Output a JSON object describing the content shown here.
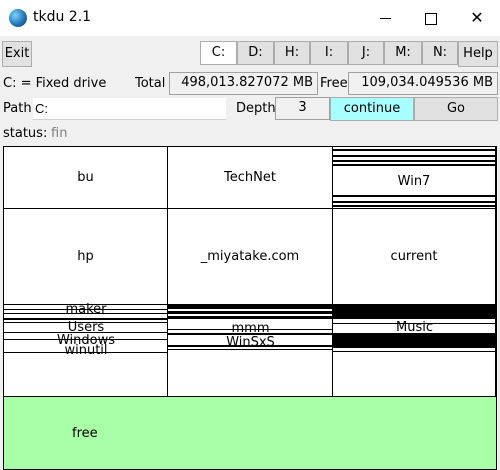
{
  "window": {
    "title": "tkdu 2.1"
  },
  "toolbar": {
    "exit_label": "Exit",
    "help_label": "Help",
    "drives": [
      {
        "label": "C:"
      },
      {
        "label": "D:"
      },
      {
        "label": "H:"
      },
      {
        "label": "I:"
      },
      {
        "label": "J:"
      },
      {
        "label": "M:"
      },
      {
        "label": "N:"
      }
    ]
  },
  "info": {
    "drive_desc": "C: = Fixed drive",
    "total_label": "Total",
    "total_value": "498,013.827072 MB",
    "free_label": "Free",
    "free_value": "109,034.049536 MB"
  },
  "path": {
    "label": "Path",
    "value": "C:",
    "depth_label": "Depth",
    "depth_value": "3",
    "continue_label": "continue",
    "go_label": "Go"
  },
  "status": {
    "label": "status:",
    "value": "fin"
  },
  "treemap": {
    "cells": [
      "bu",
      "TechNet",
      "Win7",
      "hp",
      "_miyatake.com",
      "current"
    ],
    "small": [
      "maker",
      "Users",
      "Windows",
      "winutil",
      "mmm",
      "WinSxS",
      "Music"
    ],
    "free_label": "free",
    "free_color": "#a8ffa8",
    "continue_color": "#a8ffff"
  }
}
